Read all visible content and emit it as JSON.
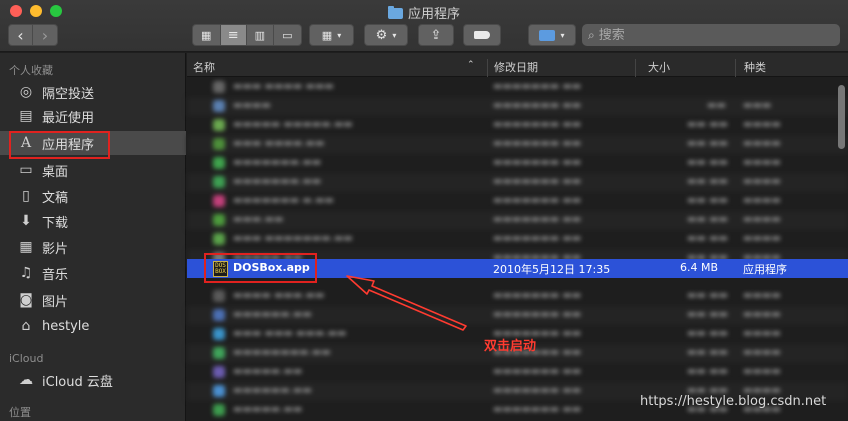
{
  "window": {
    "title": "应用程序"
  },
  "toolbar": {
    "nav_back": "‹",
    "nav_forward": "›",
    "view_icons": "▦",
    "view_list": "≡",
    "view_columns": "▥",
    "view_gallery": "▭",
    "group_label": "▦",
    "action_label": "⚙",
    "share_label": "⇪",
    "tag_label": "●",
    "search_placeholder": "搜索"
  },
  "sidebar": {
    "favorites_header": "个人收藏",
    "items": [
      {
        "label": "隔空投送",
        "icon": "airdrop-icon",
        "glyph": "◎"
      },
      {
        "label": "最近使用",
        "icon": "recents-icon",
        "glyph": "▤"
      },
      {
        "label": "应用程序",
        "icon": "applications-icon",
        "glyph": "A"
      },
      {
        "label": "桌面",
        "icon": "desktop-icon",
        "glyph": "▭"
      },
      {
        "label": "文稿",
        "icon": "documents-icon",
        "glyph": "▯"
      },
      {
        "label": "下载",
        "icon": "downloads-icon",
        "glyph": "⬇"
      },
      {
        "label": "影片",
        "icon": "movies-icon",
        "glyph": "▦"
      },
      {
        "label": "音乐",
        "icon": "music-icon",
        "glyph": "♫"
      },
      {
        "label": "图片",
        "icon": "pictures-icon",
        "glyph": "◙"
      },
      {
        "label": "hestyle",
        "icon": "home-icon",
        "glyph": "⌂"
      }
    ],
    "icloud_header": "iCloud",
    "icloud_items": [
      {
        "label": "iCloud 云盘",
        "icon": "cloud-icon",
        "glyph": "☁"
      }
    ],
    "locations_header": "位置"
  },
  "list": {
    "columns": {
      "name": "名称",
      "modified": "修改日期",
      "size": "大小",
      "kind": "种类"
    },
    "selected_row": {
      "name": "DOSBox.app",
      "modified": "2010年5月12日 17:35",
      "size": "6.4 MB",
      "kind": "应用程序",
      "icon_text": "DOS BOX"
    }
  },
  "annotation": {
    "text": "双击启动",
    "color": "#ff3b30"
  },
  "watermark": "https://hestyle.blog.csdn.net",
  "colors": {
    "selection": "#2c52d8",
    "highlight_box": "#e0221f"
  }
}
